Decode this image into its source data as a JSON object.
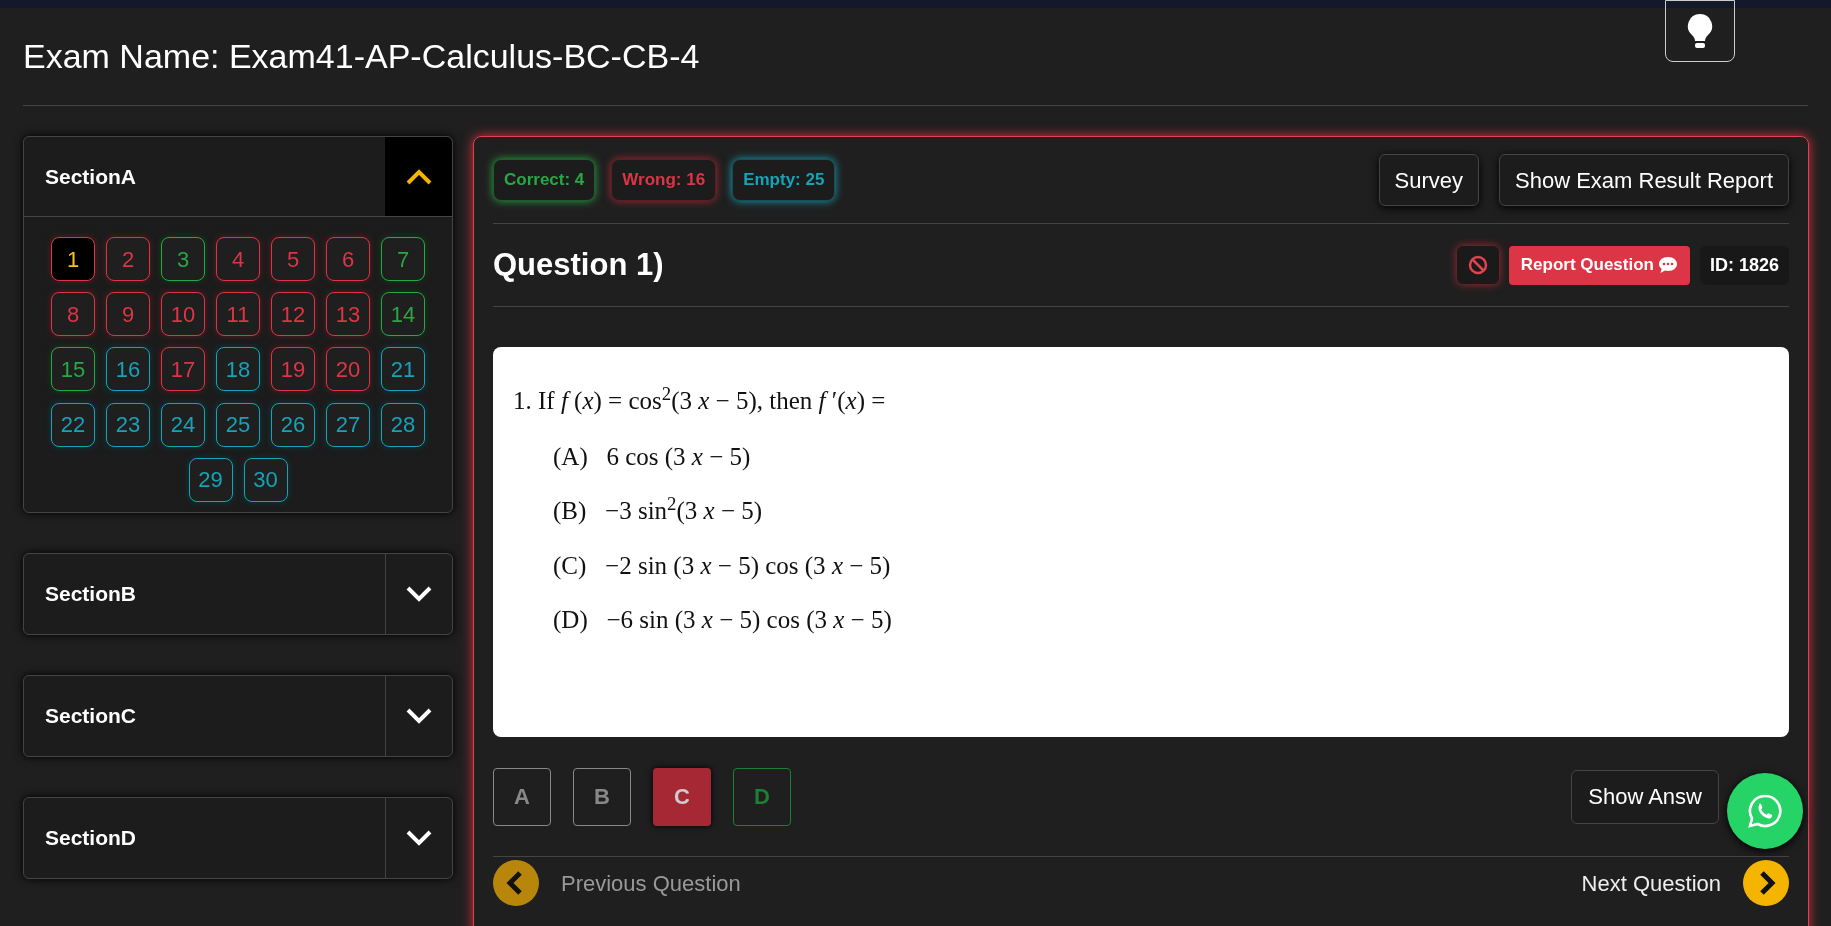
{
  "exam_title": "Exam Name: Exam41-AP-Calculus-BC-CB-4",
  "sections": [
    {
      "title": "SectionA",
      "expanded": true,
      "questions": [
        {
          "label": "1",
          "kind": "wrong",
          "selected": true
        },
        {
          "label": "2",
          "kind": "wrong",
          "selected": false
        },
        {
          "label": "3",
          "kind": "correct",
          "selected": false
        },
        {
          "label": "4",
          "kind": "wrong",
          "selected": false
        },
        {
          "label": "5",
          "kind": "wrong",
          "selected": false
        },
        {
          "label": "6",
          "kind": "wrong",
          "selected": false
        },
        {
          "label": "7",
          "kind": "correct",
          "selected": false
        },
        {
          "label": "8",
          "kind": "wrong",
          "selected": false
        },
        {
          "label": "9",
          "kind": "wrong",
          "selected": false
        },
        {
          "label": "10",
          "kind": "wrong",
          "selected": false
        },
        {
          "label": "11",
          "kind": "wrong",
          "selected": false
        },
        {
          "label": "12",
          "kind": "wrong",
          "selected": false
        },
        {
          "label": "13",
          "kind": "wrong",
          "selected": false
        },
        {
          "label": "14",
          "kind": "correct",
          "selected": false
        },
        {
          "label": "15",
          "kind": "correct",
          "selected": false
        },
        {
          "label": "16",
          "kind": "empty",
          "selected": false
        },
        {
          "label": "17",
          "kind": "wrong",
          "selected": false
        },
        {
          "label": "18",
          "kind": "empty",
          "selected": false
        },
        {
          "label": "19",
          "kind": "wrong",
          "selected": false
        },
        {
          "label": "20",
          "kind": "wrong",
          "selected": false
        },
        {
          "label": "21",
          "kind": "empty",
          "selected": false
        },
        {
          "label": "22",
          "kind": "empty",
          "selected": false
        },
        {
          "label": "23",
          "kind": "empty",
          "selected": false
        },
        {
          "label": "24",
          "kind": "empty",
          "selected": false
        },
        {
          "label": "25",
          "kind": "empty",
          "selected": false
        },
        {
          "label": "26",
          "kind": "empty",
          "selected": false
        },
        {
          "label": "27",
          "kind": "empty",
          "selected": false
        },
        {
          "label": "28",
          "kind": "empty",
          "selected": false
        },
        {
          "label": "29",
          "kind": "empty",
          "selected": false
        },
        {
          "label": "30",
          "kind": "empty",
          "selected": false
        }
      ]
    },
    {
      "title": "SectionB",
      "expanded": false
    },
    {
      "title": "SectionC",
      "expanded": false
    },
    {
      "title": "SectionD",
      "expanded": false
    }
  ],
  "stats": [
    {
      "kind": "correct",
      "text": "Correct: 4"
    },
    {
      "kind": "wrong",
      "text": "Wrong: 16"
    },
    {
      "kind": "empty",
      "text": "Empty: 25"
    }
  ],
  "top_buttons": [
    "Survey",
    "Show Exam Result Report"
  ],
  "question": {
    "title": "Question 1)",
    "report_label": "Report Question",
    "id": "ID: 1826",
    "stem": "1.  If *f* (*x*) = cos$^{2}$(3 *x* − 5), then *f* ′(*x*) =",
    "choices": [
      "(A)   6 cos (3 *x* − 5)",
      "(B)   −3 sin$^{2}$(3 *x* − 5)",
      "(C)   −2 sin (3 *x* − 5) cos (3 *x* − 5)",
      "(D)   −6 sin (3 *x* − 5) cos (3 *x* − 5)"
    ]
  },
  "answers": [
    {
      "label": "A",
      "kind": "neutral",
      "selected": false
    },
    {
      "label": "B",
      "kind": "neutral",
      "selected": false
    },
    {
      "label": "C",
      "kind": "wrong",
      "selected": true
    },
    {
      "label": "D",
      "kind": "correct",
      "selected": false
    }
  ],
  "show_answer": "Show Answ",
  "nav": {
    "previous": "Previous Question",
    "next": "Next Question"
  }
}
